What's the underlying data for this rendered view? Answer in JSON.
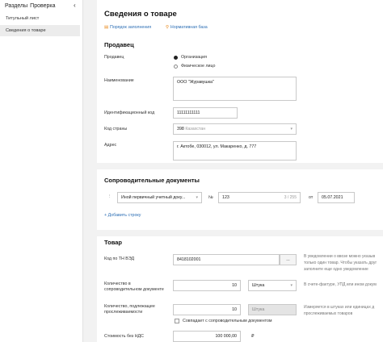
{
  "sidebar": {
    "tabs": [
      "Разделы",
      "Проверка"
    ],
    "back_icon": "chevron-left-icon",
    "items": [
      {
        "label": "Титульный лист",
        "active": false
      },
      {
        "label": "Сведения о товаре",
        "active": true
      }
    ]
  },
  "header": {
    "title": "Сведения о товаре",
    "links": [
      {
        "icon": "document-icon",
        "label": "Порядок заполнения"
      },
      {
        "icon": "search-icon",
        "label": "Нормативная база"
      }
    ]
  },
  "seller": {
    "heading": "Продавец",
    "seller_label": "Продавец",
    "options": [
      {
        "label": "Организация",
        "selected": true
      },
      {
        "label": "Физическое лицо",
        "selected": false
      }
    ],
    "name_label": "Наименование",
    "name_value": "ООО \"Журавушка\"",
    "id_label": "Идентификационный код",
    "id_value": "11111111111",
    "country_label": "Код страны",
    "country_code": "398",
    "country_name": "Казахстан",
    "address_label": "Адрес",
    "address_value": "г. Актобе, 030012, ул. Макаренко, д. 777"
  },
  "docs": {
    "heading": "Сопроводительные документы",
    "doc_type": "Иной первичный учетный доку...",
    "number_label": "№",
    "number_value": "123",
    "number_counter": "3 / 255",
    "date_label": "от",
    "date_value": "05.07.2021",
    "add_label": "+ Добавить строку"
  },
  "goods": {
    "heading": "Товар",
    "tnved_label": "Код по ТН ВЭД",
    "tnved_value": "8418102001",
    "tnved_button": "...",
    "qty_label": "Количество в сопроводительном документе",
    "qty_value": "10",
    "qty_unit": "Штука",
    "qty2_label": "Количество, подлежащее прослеживаемости",
    "qty2_value": "10",
    "qty2_unit": "Штука",
    "match_label": "Совпадает с сопроводительным документом",
    "cost_label": "Стоимость без НДС",
    "cost_value": "100 000,00",
    "cost_currency": "₽",
    "hints": [
      "В уведомлении о ввозе можно указыв",
      "только один товар. Чтобы указать друг",
      "заполните еще одно уведомление",
      "В счете-фактуре, УПД или ином докум",
      "Измеряется в штуках или единицах д",
      "прослеживаемых товаров"
    ]
  }
}
